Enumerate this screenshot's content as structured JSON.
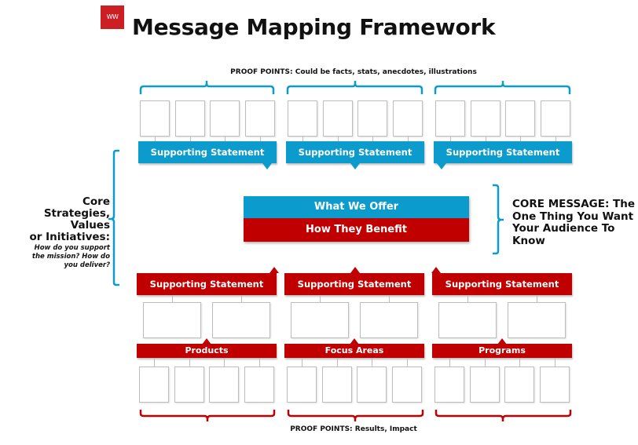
{
  "header": {
    "logo_text": "WW",
    "title": "Message Mapping Framework"
  },
  "colors": {
    "blue": "#0b9ccd",
    "red": "#c00000",
    "logo_red": "#cc1f24",
    "box_border": "#bdbdbd"
  },
  "proof_points_top": "PROOF POINTS: Could be  facts, stats, anecdotes, illustrations",
  "proof_points_bottom": "PROOF POINTS: Results, Impact",
  "top_supporting": [
    {
      "label": "Supporting Statement",
      "proof_boxes": 4
    },
    {
      "label": "Supporting Statement",
      "proof_boxes": 4
    },
    {
      "label": "Supporting Statement",
      "proof_boxes": 4
    }
  ],
  "core": {
    "offer": "What We Offer",
    "benefit": "How They Benefit"
  },
  "left_label": {
    "lines": [
      "Core",
      "Strategies,",
      "Values",
      "or Initiatives:"
    ],
    "sub_lines": [
      "How do you support",
      "the mission? How do",
      "you deliver?"
    ]
  },
  "right_label": {
    "lines": [
      "CORE MESSAGE: The",
      "One Thing You Want",
      "Your Audience To",
      "Know"
    ]
  },
  "bottom_supporting": [
    {
      "label": "Supporting Statement",
      "category": "Products",
      "mid_boxes": 2,
      "proof_boxes": 4
    },
    {
      "label": "Supporting Statement",
      "category": "Focus Areas",
      "mid_boxes": 2,
      "proof_boxes": 4
    },
    {
      "label": "Supporting Statement",
      "category": "Programs",
      "mid_boxes": 2,
      "proof_boxes": 4
    }
  ]
}
